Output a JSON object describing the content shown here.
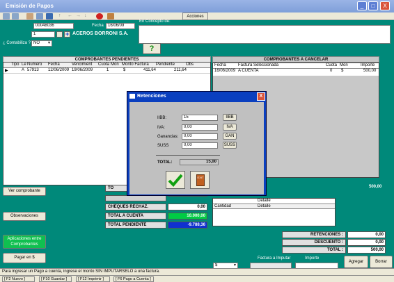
{
  "window": {
    "title": "Emisión de Pagos",
    "btn_min": "_",
    "btn_max": "□",
    "btn_close": "X"
  },
  "toolbar": {
    "acciones": "Acciones"
  },
  "form": {
    "numero": "00048036",
    "fecha_label": "Fecha",
    "fecha": "16/06/09",
    "proveedor_code": "1",
    "proveedor_name": "ACEROS BORRONI S.A.",
    "contabiliza_label": "¿ Contabiliza ?",
    "contabiliza_value": "NO",
    "concepto_label": "En Concepto de:"
  },
  "pendientes": {
    "title": "COMPROBANTES PENDIENTES",
    "columns": [
      "Tipo",
      "Le",
      "Numero",
      "Fecha",
      "Vencimient",
      "Cuota",
      "Mon",
      "Monto Factura",
      "Pendiente",
      "Obs"
    ],
    "rows": [
      [
        "",
        "A",
        "57913",
        "12/06/2009",
        "19/06/2009",
        "1",
        "$",
        "411,64",
        "211,64",
        ""
      ]
    ]
  },
  "cancelar": {
    "title": "COMPROBANTES A CANCELAR",
    "columns": [
      "Fecha",
      "Factura Seleccionada",
      "Cuota",
      "Mon",
      "Importe"
    ],
    "rows": [
      [
        "16/06/2009",
        "A CUENTA",
        "0",
        "$",
        "500,00"
      ]
    ],
    "total": "500,00"
  },
  "detalle": {
    "col_cantidad": "Cantidad",
    "col_detalle": "Detalle",
    "header": "Detalle"
  },
  "buttons": {
    "ver_comprobante": "Ver comprobante",
    "observaciones": "Observaciones",
    "aplicaciones_1": "Aplicaciones entre",
    "aplicaciones_2": "Comprobantes",
    "pagar": "Pagar en $",
    "agregar": "Agregar",
    "borrar": "Borrar"
  },
  "totals_left": {
    "to_label": "TO",
    "cheques_label": "CHEQUES RECHAZ.",
    "cheques": "0,00",
    "acuenta_label": "TOTAL A CUENTA",
    "acuenta": "10.000,00",
    "pendiente_label": "TOTAL PENDIENTE",
    "pendiente": "-9.788,36"
  },
  "totals_right": {
    "retenciones_label": "RETENCIONES :",
    "retenciones": "0,00",
    "descuento_label": "DESCUENTO :",
    "descuento": "0,00",
    "total_label": "TOTAL :",
    "total": "500,00"
  },
  "bottom": {
    "moneda": "$",
    "factura_label": "Factura a Imputar",
    "importe_label": "Importe"
  },
  "status": "Para ingresar un Pago a cuenta, ingrese el monto SIN IMPUTARSELO a una factura.",
  "fkeys": [
    "[ F2 Nuevo ]",
    "[ F10 Guardar ]",
    "[ F12 Imprimir ]",
    "[ F6 Pago a Cuenta ]"
  ],
  "modal": {
    "title": "Retenciones",
    "close": "X",
    "iibb_label": "IIBB:",
    "iibb": "15",
    "iva_label": "IVA:",
    "iva": "0,00",
    "ganancias_label": "Ganancias:",
    "ganancias": "0,00",
    "suss_label": "SUSS",
    "suss": "0,00",
    "btn_iibb": "IIBB",
    "btn_iva": "IVA",
    "btn_gan": "GAN",
    "btn_suss": "SUSS",
    "total_label": "TOTAL:",
    "total": "15,00",
    "exit_text": "EXIT"
  },
  "colors": {
    "teal": "#00897a",
    "green_field": "#00cc44",
    "blue_field": "#1030d0",
    "modal_blue": "#0a3fbf"
  }
}
